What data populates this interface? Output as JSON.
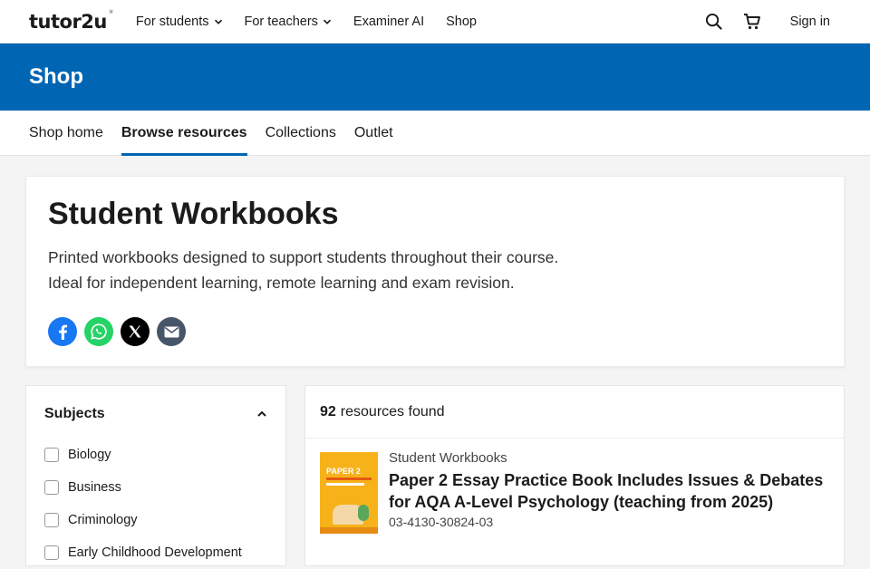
{
  "header": {
    "logo_text": "tutor2u",
    "nav": [
      {
        "label": "For students",
        "dropdown": true
      },
      {
        "label": "For teachers",
        "dropdown": true
      },
      {
        "label": "Examiner AI",
        "dropdown": false
      },
      {
        "label": "Shop",
        "dropdown": false
      }
    ],
    "sign_in_label": "Sign in",
    "icons": [
      "search-icon",
      "cart-icon"
    ]
  },
  "banner": {
    "title": "Shop",
    "background": "#0065b3"
  },
  "subnav": {
    "items": [
      {
        "label": "Shop home",
        "active": false
      },
      {
        "label": "Browse resources",
        "active": true
      },
      {
        "label": "Collections",
        "active": false
      },
      {
        "label": "Outlet",
        "active": false
      }
    ]
  },
  "hero": {
    "title": "Student Workbooks",
    "description_line1": "Printed workbooks designed to support students throughout their course.",
    "description_line2": "Ideal for independent learning, remote learning and exam revision.",
    "share": [
      {
        "name": "facebook-icon",
        "color": "#1877f2"
      },
      {
        "name": "whatsapp-icon",
        "color": "#25d366"
      },
      {
        "name": "x-icon",
        "color": "#000000"
      },
      {
        "name": "email-icon",
        "color": "#475569"
      }
    ]
  },
  "filters": {
    "title": "Subjects",
    "options": [
      {
        "label": "Biology",
        "checked": false
      },
      {
        "label": "Business",
        "checked": false
      },
      {
        "label": "Criminology",
        "checked": false
      },
      {
        "label": "Early Childhood Development",
        "checked": false
      }
    ]
  },
  "results": {
    "count": "92",
    "count_suffix": "resources found",
    "items": [
      {
        "category": "Student Workbooks",
        "title": "Paper 2 Essay Practice Book Includes Issues & Debates for AQA A-Level Psychology (teaching from 2025)",
        "code": "03-4130-30824-03",
        "thumb_label": "PAPER 2"
      }
    ]
  }
}
